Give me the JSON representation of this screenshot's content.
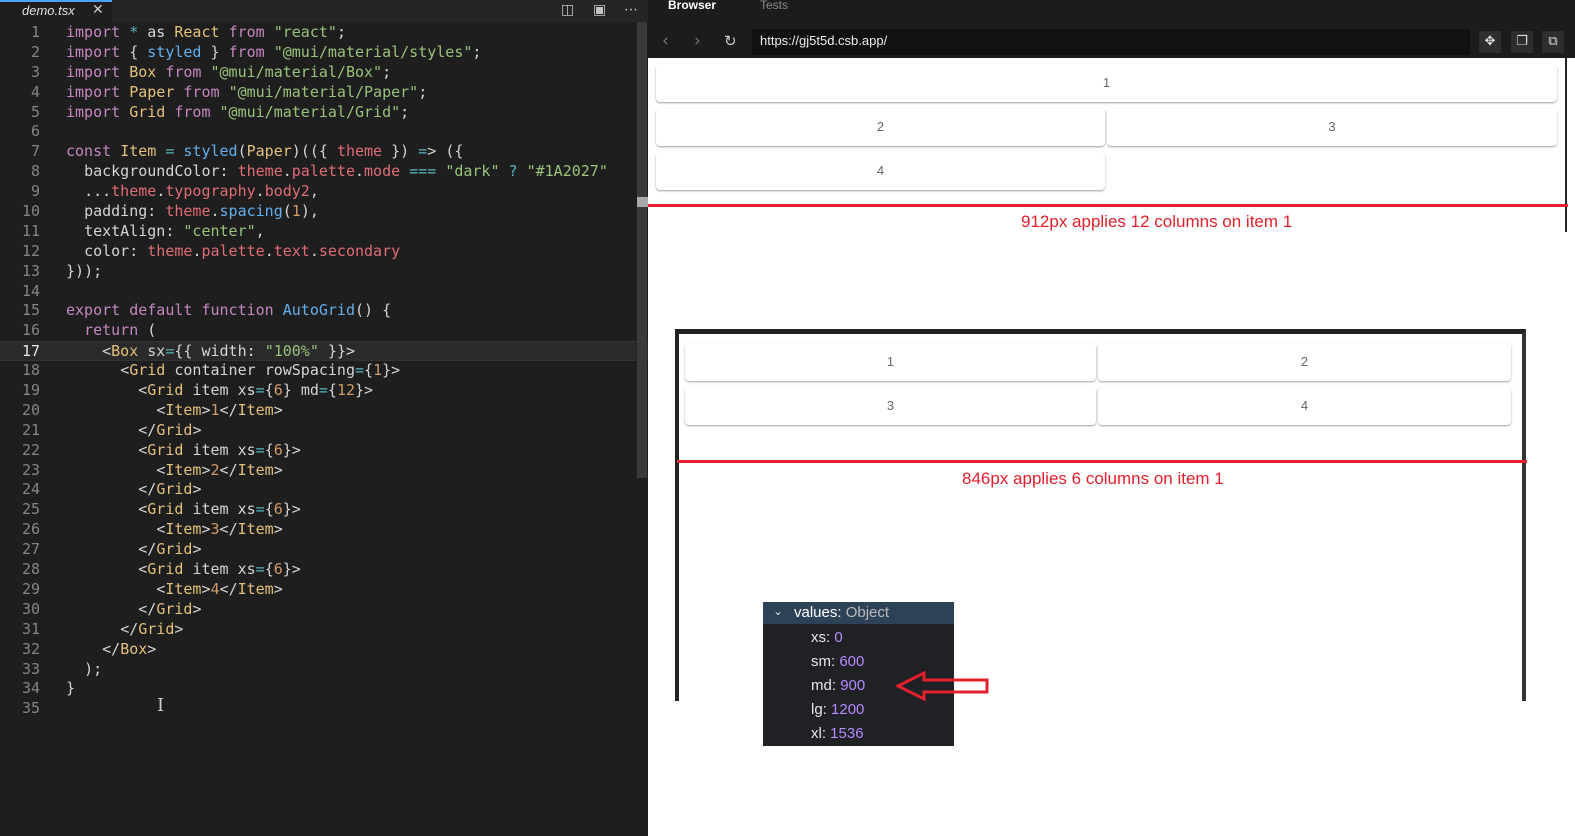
{
  "editor": {
    "tab": {
      "filename": "demo.tsx",
      "close_icon": "close-icon"
    },
    "actions": [
      "split-editor-icon",
      "open-preview-icon",
      "more-actions-icon"
    ],
    "active_line": 17,
    "lines": [
      "import * as React from \"react\";",
      "import { styled } from \"@mui/material/styles\";",
      "import Box from \"@mui/material/Box\";",
      "import Paper from \"@mui/material/Paper\";",
      "import Grid from \"@mui/material/Grid\";",
      "",
      "const Item = styled(Paper)(({ theme }) => ({",
      "  backgroundColor: theme.palette.mode === \"dark\" ? \"#1A2027\"",
      "  ...theme.typography.body2,",
      "  padding: theme.spacing(1),",
      "  textAlign: \"center\",",
      "  color: theme.palette.text.secondary",
      "}));",
      "",
      "export default function AutoGrid() {",
      "  return (",
      "    <Box sx={{ width: \"100%\" }}>",
      "      <Grid container rowSpacing={1}>",
      "        <Grid item xs={6} md={12}>",
      "          <Item>1</Item>",
      "        </Grid>",
      "        <Grid item xs={6}>",
      "          <Item>2</Item>",
      "        </Grid>",
      "        <Grid item xs={6}>",
      "          <Item>3</Item>",
      "        </Grid>",
      "        <Grid item xs={6}>",
      "          <Item>4</Item>",
      "        </Grid>",
      "      </Grid>",
      "    </Box>",
      "  );",
      "}",
      ""
    ]
  },
  "browser": {
    "tabs": [
      {
        "label": "Browser",
        "active": true
      },
      {
        "label": "Tests",
        "active": false
      }
    ],
    "url": "https://gj5t5d.csb.app/",
    "nav_icons": [
      "back-arrow-icon",
      "forward-arrow-icon",
      "reload-icon"
    ],
    "right_icons": [
      "devtools-icon",
      "copy-icon",
      "open-new-window-icon"
    ],
    "preview1": {
      "items": [
        "1",
        "2",
        "3",
        "4"
      ],
      "annotation": "912px applies 12 columns on item 1"
    },
    "preview2": {
      "items": [
        "1",
        "2",
        "3",
        "4"
      ],
      "annotation": "846px applies 6 columns on item 1"
    }
  },
  "devtools": {
    "title": "values:",
    "type": "Object",
    "values": [
      {
        "key": "xs:",
        "value": "0"
      },
      {
        "key": "sm:",
        "value": "600"
      },
      {
        "key": "md:",
        "value": "900"
      },
      {
        "key": "lg:",
        "value": "1200"
      },
      {
        "key": "xl:",
        "value": "1536"
      }
    ]
  },
  "colors": {
    "annotation_red": "#e3202c",
    "editor_bg": "#1e1e1e",
    "devtools_header": "#2e4257",
    "devtools_value": "#b58bff"
  }
}
